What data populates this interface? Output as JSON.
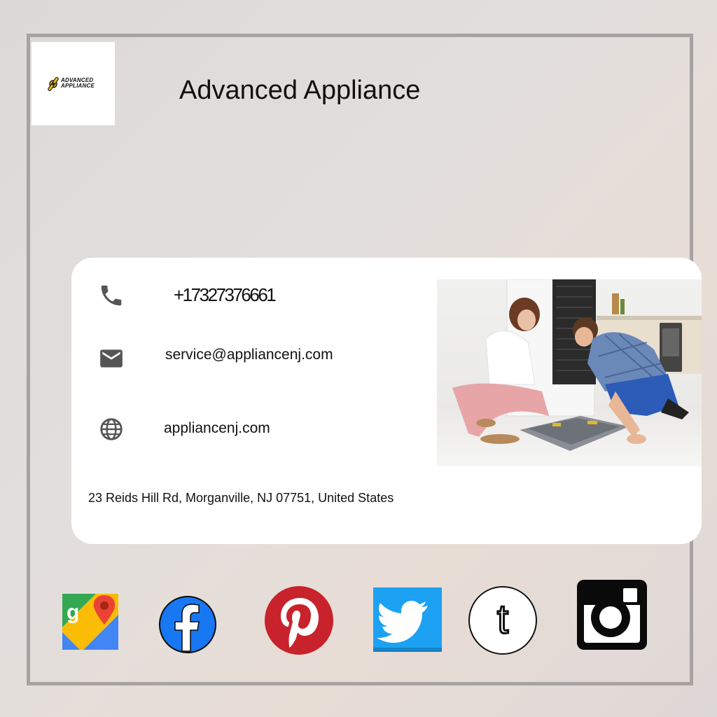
{
  "business": {
    "name": "Advanced Appliance",
    "logo_line1": "ADVANCED",
    "logo_line2": "APPLIANCE"
  },
  "contact": {
    "phone": "+17327376661",
    "email": "service@appliancenj.com",
    "website": "appliancenj.com",
    "address": "23 Reids Hill Rd, Morganville, NJ 07751, United States"
  },
  "icons": {
    "phone": "phone-icon",
    "email": "email-icon",
    "website": "globe-icon"
  },
  "social": [
    {
      "icon": "google-maps-icon"
    },
    {
      "icon": "facebook-icon"
    },
    {
      "icon": "pinterest-icon"
    },
    {
      "icon": "twitter-icon"
    },
    {
      "icon": "tumblr-icon"
    },
    {
      "icon": "instagram-icon"
    }
  ],
  "colors": {
    "frame": "#a8a3a3",
    "facebook": "#1877f2",
    "pinterest": "#c8232c",
    "twitter": "#1da1f2",
    "icon_gray": "#555555"
  }
}
